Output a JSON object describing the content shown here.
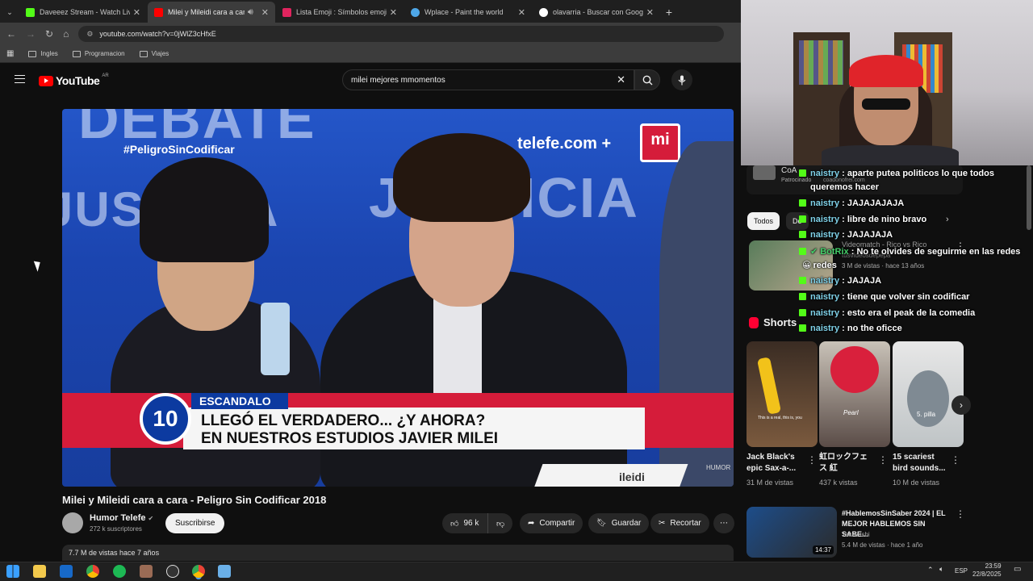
{
  "browser": {
    "tabs": [
      {
        "title": "Daveeez Stream - Watch Live o...",
        "fav_color": "#53fc18",
        "active": false
      },
      {
        "title": "Milei y Mileidi cara a cara -",
        "fav_color": "#ff0000",
        "active": true
      },
      {
        "title": "Lista Emoji : Símbolos emoji na",
        "fav_color": "#e0245e",
        "active": false
      },
      {
        "title": "Wplace - Paint the world",
        "fav_color": "#4ea7e8",
        "active": false
      },
      {
        "title": "olavarria - Buscar con Google",
        "fav_color": "#ffffff",
        "active": false
      }
    ],
    "new_tab": "+",
    "url": "youtube.com/watch?v=0jWlZ3cHfxE",
    "bookmarks": [
      "Ingles",
      "Programacion",
      "Viajes"
    ]
  },
  "youtube": {
    "logo_text": "YouTube",
    "country": "AR",
    "search_value": "milei mejores mmomentos"
  },
  "video": {
    "overlay": {
      "bg_left": "DEBATE",
      "bg_right": "JUSTICIA",
      "bg_left2": "JUSTICIA",
      "hashtag": "#PeligroSinCodificar",
      "site": "telefe.com",
      "plus": "+",
      "logo": "mi",
      "number": "10",
      "tag": "ESCANDALO",
      "line1": "LLEGÓ EL VERDADERO... ¿Y AHORA?",
      "line2": "EN NUESTROS ESTUDIOS JAVIER MILEI",
      "watermark": "HUMOR",
      "partial_text": "ileidi"
    },
    "title": "Milei y Mileidi cara a cara - Peligro Sin Codificar 2018",
    "channel": "Humor Telefe",
    "subscribers": "272 k suscriptores",
    "subscribe_label": "Suscribirse",
    "likes": "96 k",
    "share": "Compartir",
    "save": "Guardar",
    "clip": "Recortar",
    "views_meta": "7.7 M de vistas  hace 7 años"
  },
  "sidebar": {
    "ad_channel": "CoA",
    "ad_label": "Patrocinado",
    "ad_url": "coadonofrei.com",
    "chips": [
      "Todos",
      "De",
      "Videomatch - Rico vs Rico"
    ],
    "related_title": "Videomatch - Rico vs Rico",
    "related_channel": "tusvideosdepepa",
    "related_views": "3 M de vistas · hace 13 años",
    "shorts_label": "Shorts",
    "shorts": [
      {
        "title": "Jack Black's epic Sax-a-...",
        "views": "31 M de vistas",
        "caption": "This is a real, this is, you"
      },
      {
        "title": "虹ロックフェス 紅",
        "views": "437 k vistas",
        "caption": "Pearl"
      },
      {
        "title": "15 scariest bird sounds...",
        "views": "10 M de vistas",
        "caption": "5. pilla"
      }
    ],
    "bottom_video": {
      "title": "#HablemosSinSaber 2024 | EL MEJOR HABLEMOS SIN SABE...",
      "channel": "Takawishi",
      "views": "5.4 M de vistas · hace 1 año",
      "duration": "14:37"
    }
  },
  "chat": [
    {
      "user": "naistry",
      "msg": ": aparte putea politicos lo que todos",
      "bot": false
    },
    {
      "user": "",
      "msg": "queremos hacer",
      "bot": false
    },
    {
      "user": "naistry",
      "msg": ": JAJAJAJAJA",
      "bot": false
    },
    {
      "user": "naistry",
      "msg": ": libre de nino bravo",
      "bot": false
    },
    {
      "user": "naistry",
      "msg": ": JAJAJAJA",
      "bot": false
    },
    {
      "user": "BotRix",
      "msg": ": No te olvides de seguirme en las redes",
      "bot": true
    },
    {
      "user": "",
      "msg": "redes",
      "bot": false
    },
    {
      "user": "naistry",
      "msg": ": JAJAJA",
      "bot": false
    },
    {
      "user": "naistry",
      "msg": ": tiene que volver sin codificar",
      "bot": false
    },
    {
      "user": "naistry",
      "msg": ": esto era el peak de la comedia",
      "bot": false
    },
    {
      "user": "naistry",
      "msg": ": no the oficce",
      "bot": false
    }
  ],
  "taskbar": {
    "lang": "ESP",
    "time": "23:59",
    "date": "22/8/2025"
  }
}
